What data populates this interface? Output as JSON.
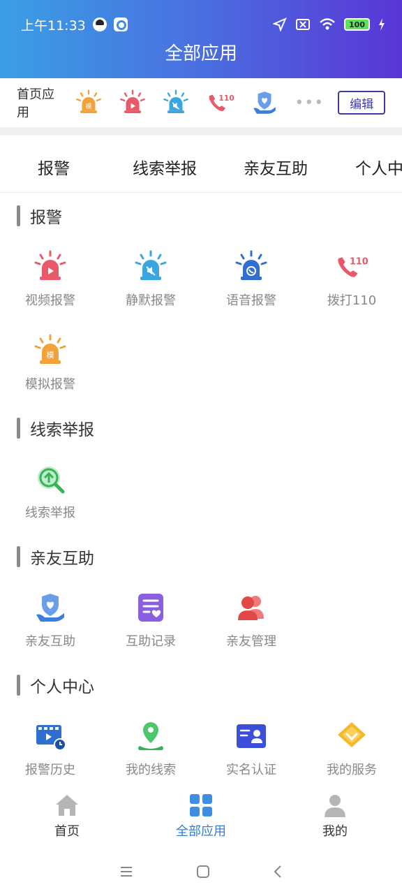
{
  "status": {
    "time": "上午11:33",
    "battery": "100"
  },
  "header": {
    "title": "全部应用"
  },
  "quickbar": {
    "label": "首页应用",
    "icons": [
      "mock-alarm-icon",
      "video-alarm-icon",
      "silent-alarm-icon",
      "dial-110-icon",
      "family-help-icon"
    ],
    "more": "•••",
    "edit_label": "编辑"
  },
  "tabs": [
    "报警",
    "线索举报",
    "亲友互助",
    "个人中"
  ],
  "sections": [
    {
      "title": "报警",
      "apps": [
        {
          "label": "视频报警",
          "icon": "video-alarm-icon"
        },
        {
          "label": "静默报警",
          "icon": "silent-alarm-icon"
        },
        {
          "label": "语音报警",
          "icon": "voice-alarm-icon"
        },
        {
          "label": "拨打110",
          "icon": "dial-110-icon"
        },
        {
          "label": "模拟报警",
          "icon": "mock-alarm-icon"
        }
      ]
    },
    {
      "title": "线索举报",
      "apps": [
        {
          "label": "线索举报",
          "icon": "clue-report-icon"
        }
      ]
    },
    {
      "title": "亲友互助",
      "apps": [
        {
          "label": "亲友互助",
          "icon": "family-help-icon"
        },
        {
          "label": "互助记录",
          "icon": "help-record-icon"
        },
        {
          "label": "亲友管理",
          "icon": "family-manage-icon"
        }
      ]
    },
    {
      "title": "个人中心",
      "apps": [
        {
          "label": "报警历史",
          "icon": "alarm-history-icon"
        },
        {
          "label": "我的线索",
          "icon": "my-clues-icon"
        },
        {
          "label": "实名认证",
          "icon": "real-name-icon"
        },
        {
          "label": "我的服务",
          "icon": "my-services-icon"
        }
      ]
    }
  ],
  "bottomnav": [
    {
      "label": "首页",
      "icon": "home-icon"
    },
    {
      "label": "全部应用",
      "icon": "grid-icon",
      "active": true
    },
    {
      "label": "我的",
      "icon": "profile-icon"
    }
  ],
  "colors": {
    "accent": "#2f7fd4",
    "edit": "#3d3aa8",
    "alarm_red": "#e85a6a",
    "alarm_blue": "#3aa6e0",
    "alarm_orange": "#f3a23a"
  }
}
